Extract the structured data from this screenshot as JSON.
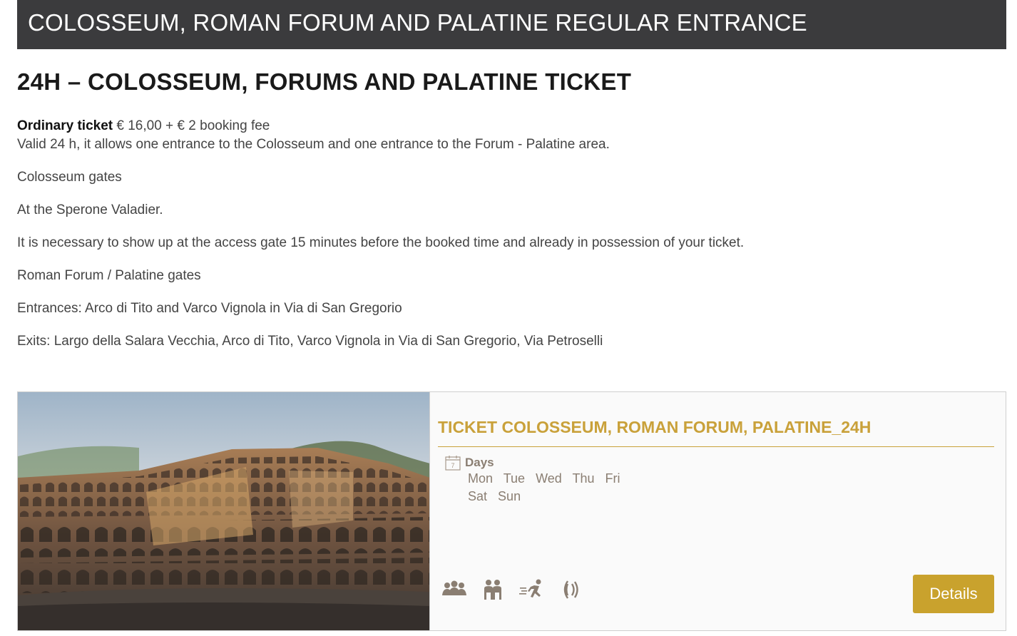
{
  "banner": {
    "title": "COLOSSEUM, ROMAN FORUM AND PALATINE REGULAR ENTRANCE"
  },
  "ticket": {
    "heading": "24H – COLOSSEUM, FORUMS AND PALATINE TICKET",
    "ordinary_label": "Ordinary ticket",
    "price": " € 16,00 + € 2 booking fee",
    "validity": "Valid 24 h, it allows one entrance to the Colosseum and one entrance to the Forum - Palatine area.",
    "colosseum_gates_title": "Colosseum gates",
    "colosseum_gates_location": "At the Sperone Valadier.",
    "colosseum_gates_note": "It is necessary to show up at the access gate 15 minutes before the booked time and already in possession of your ticket.",
    "forum_gates_title": "Roman Forum / Palatine gates",
    "forum_entrances": "Entrances: Arco di Tito and Varco Vignola in Via di San Gregorio",
    "forum_exits": "Exits: Largo della Salara Vecchia, Arco di Tito, Varco Vignola in Via di San Gregorio, Via Petroselli"
  },
  "card": {
    "title": "TICKET COLOSSEUM, ROMAN FORUM, PALATINE_24H",
    "calendar_icon_number": "7",
    "days_label": "Days",
    "days": [
      "Mon",
      "Tue",
      "Wed",
      "Thu",
      "Fri",
      "Sat",
      "Sun"
    ],
    "feature_icons": [
      "group-icon",
      "couple-icon",
      "running-person-icon",
      "audio-guide-icon"
    ],
    "details_label": "Details",
    "accent_color": "#c9a22d"
  }
}
